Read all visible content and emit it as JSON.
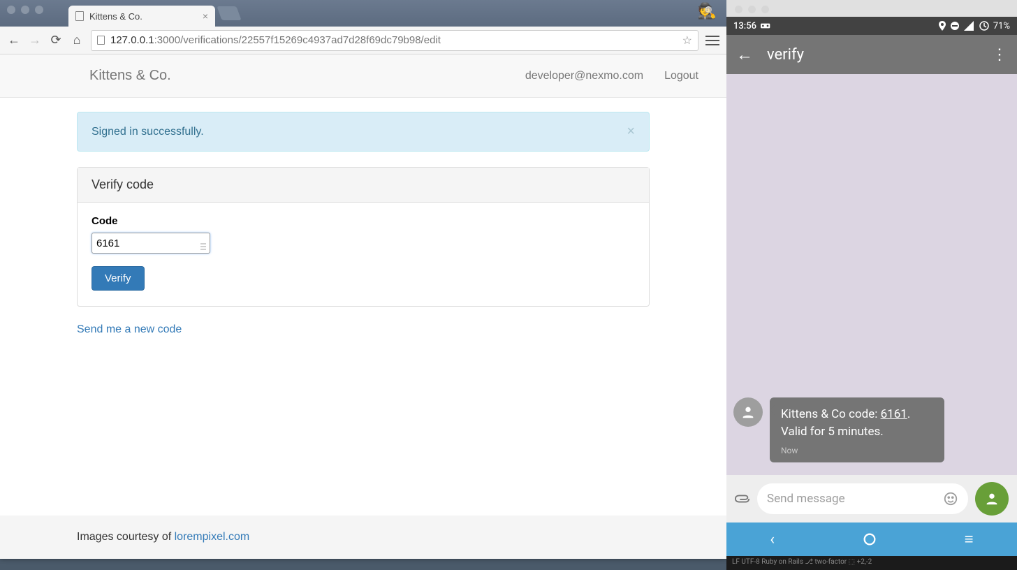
{
  "browser": {
    "tab_title": "Kittens & Co.",
    "url_host": "127.0.0.1",
    "url_port": ":3000",
    "url_path": "/verifications/22557f15269c4937ad7d28f69dc79b98/edit"
  },
  "navbar": {
    "brand": "Kittens & Co.",
    "user_email": "developer@nexmo.com",
    "logout": "Logout"
  },
  "alert": {
    "message": "Signed in successfully."
  },
  "panel": {
    "heading": "Verify code",
    "code_label": "Code",
    "code_value": "6161",
    "verify_button": "Verify"
  },
  "resend_link": "Send me a new code",
  "footer": {
    "prefix": "Images courtesy of ",
    "link_text": "lorempixel.com"
  },
  "phone": {
    "status": {
      "time": "13:56",
      "battery": "71%"
    },
    "appbar_title": "verify",
    "sms": {
      "line1_prefix": "Kittens & Co code: ",
      "code": "6161",
      "line1_suffix": ".",
      "line2": "Valid for 5 minutes.",
      "timestamp": "Now"
    },
    "compose_placeholder": "Send message",
    "bottom_strip": "LF   UTF-8    Ruby on Rails   ⎇ two-factor   ⬚ +2,-2"
  }
}
